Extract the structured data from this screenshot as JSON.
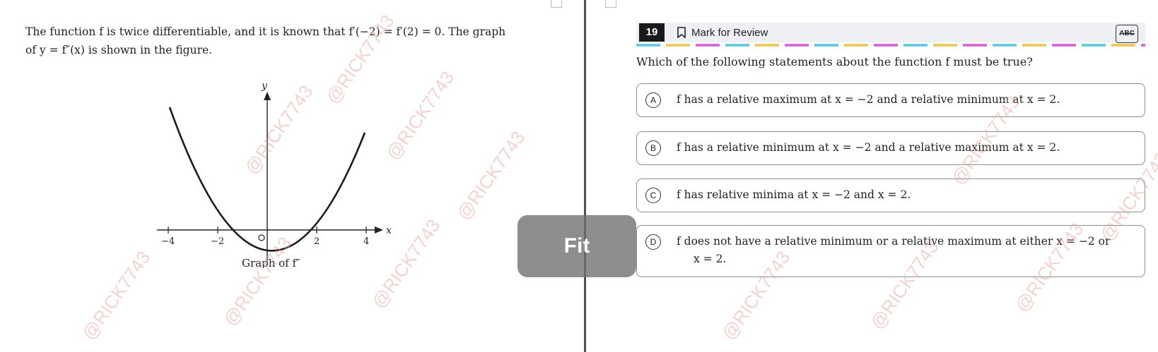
{
  "left_pane": {
    "question_line1": "The function f is twice differentiable, and it is known that f′(−2) = f′(2) = 0. The graph",
    "question_line2": "of y = f″(x) is shown in the figure.",
    "graph": {
      "y_label": "y",
      "x_label": "x",
      "ticks": [
        "−4",
        "−2",
        "2",
        "4"
      ],
      "caption": "Graph of f″",
      "curve_color": "#1a1a1a"
    }
  },
  "header": {
    "question_number": "19",
    "mark_label": "Mark for Review",
    "tool_label": "ABC",
    "progress_colors": [
      "#59c6d9",
      "#e9c74d",
      "#d65bd2"
    ]
  },
  "prompt": "Which of the following statements about the function f must be true?",
  "choices": [
    {
      "letter": "A",
      "text": "f has a relative maximum at x = −2 and a relative minimum at x = 2."
    },
    {
      "letter": "B",
      "text": "f has a relative minimum at x = −2 and a relative maximum at x = 2."
    },
    {
      "letter": "C",
      "text": "f has relative minima at x = −2 and x = 2."
    },
    {
      "letter": "D",
      "text": "f does not have a relative minimum or a relative maximum at either x = −2 or",
      "text2": "x = 2."
    }
  ],
  "overlay": {
    "label": "Fit"
  },
  "watermark": {
    "text": "@RICK7743",
    "color": "#e6a09a"
  }
}
